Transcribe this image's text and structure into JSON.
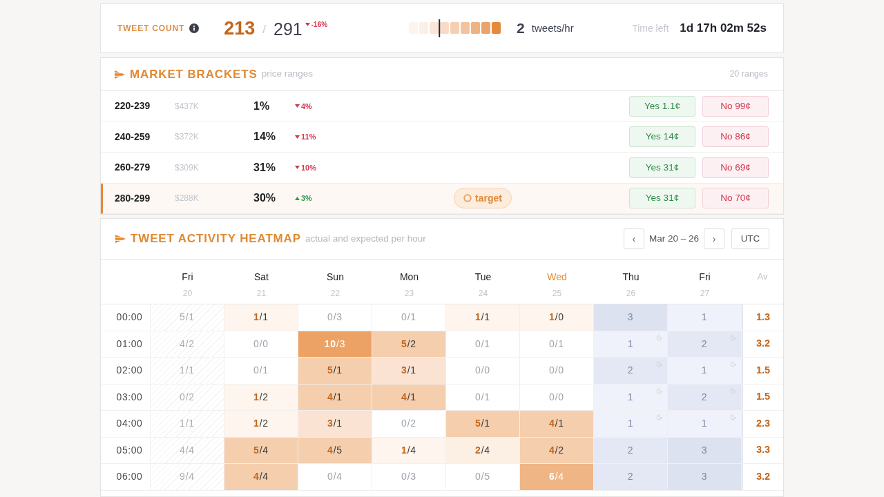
{
  "tweet_count": {
    "label": "TWEET COUNT",
    "current": "213",
    "separator": "/",
    "target": "291",
    "change": {
      "increase": false,
      "text": "-16%"
    }
  },
  "rate": {
    "level": 0.33,
    "value": "2",
    "unit": "tweets/hr"
  },
  "time_left": {
    "label": "Time left",
    "value": "1d 17h 02m 52s"
  },
  "market_brackets": {
    "title": "MARKET BRACKETS",
    "subtitle": "price ranges",
    "count": "20 ranges",
    "rows": [
      {
        "range": "220-239",
        "volume": "$437K",
        "probability": "1%",
        "change": {
          "increase": false,
          "text": "4%"
        },
        "target": false,
        "yes": "Yes 1.1¢",
        "no": "No 99¢"
      },
      {
        "range": "240-259",
        "volume": "$372K",
        "probability": "14%",
        "change": {
          "increase": false,
          "text": "11%"
        },
        "target": false,
        "yes": "Yes 14¢",
        "no": "No 86¢"
      },
      {
        "range": "260-279",
        "volume": "$309K",
        "probability": "31%",
        "change": {
          "increase": false,
          "text": "10%"
        },
        "target": false,
        "yes": "Yes 31¢",
        "no": "No 69¢"
      },
      {
        "range": "280-299",
        "volume": "$288K",
        "probability": "30%",
        "change": {
          "increase": true,
          "text": "3%"
        },
        "target": true,
        "tag": "target",
        "yes": "Yes 31¢",
        "no": "No 70¢"
      }
    ]
  },
  "heatmap": {
    "title": "TWEET ACTIVITY HEATMAP",
    "subtitle": "actual and expected per hour",
    "prev": "‹",
    "range": "Mar 20 – 26",
    "next": "›",
    "timezone": "UTC",
    "days": [
      {
        "name": "Fri",
        "date": "20",
        "today": false
      },
      {
        "name": "Sat",
        "date": "21",
        "today": false
      },
      {
        "name": "Sun",
        "date": "22",
        "today": false
      },
      {
        "name": "Mon",
        "date": "23",
        "today": false
      },
      {
        "name": "Tue",
        "date": "24",
        "today": false
      },
      {
        "name": "Wed",
        "date": "25",
        "today": true
      },
      {
        "name": "Thu",
        "date": "26",
        "today": false
      },
      {
        "name": "Fri",
        "date": "27",
        "today": false
      }
    ],
    "average_header": "Av",
    "rows": [
      {
        "time": "00:00",
        "average": "1.3",
        "cells": [
          {
            "kind": "past",
            "text": "5/1"
          },
          {
            "kind": "actual",
            "text": "**1**/1",
            "color": "#fdf5ee"
          },
          {
            "kind": "empty",
            "text": "0/3"
          },
          {
            "kind": "empty",
            "text": "0/1"
          },
          {
            "kind": "actual",
            "text": "**1**/1",
            "color": "#fdf5ee"
          },
          {
            "kind": "actual",
            "text": "**1**/0",
            "color": "#fdf5ee"
          },
          {
            "kind": "forecast",
            "text": "3",
            "color": "#dde2f1",
            "night": false
          },
          {
            "kind": "forecast",
            "text": "1",
            "color": "#eff2fa",
            "night": false
          }
        ]
      },
      {
        "time": "01:00",
        "average": "3.2",
        "cells": [
          {
            "kind": "past",
            "text": "4/2"
          },
          {
            "kind": "empty",
            "text": "0/0"
          },
          {
            "kind": "peak",
            "text": "**10**/3",
            "color": "#eca264"
          },
          {
            "kind": "actual",
            "text": "**5**/2",
            "color": "#f5ceae"
          },
          {
            "kind": "empty",
            "text": "0/1"
          },
          {
            "kind": "empty",
            "text": "0/1"
          },
          {
            "kind": "forecast",
            "text": "1",
            "color": "#eff2fa",
            "night": true
          },
          {
            "kind": "forecast",
            "text": "2",
            "color": "#e3e8f4",
            "night": true
          }
        ]
      },
      {
        "time": "02:00",
        "average": "1.5",
        "cells": [
          {
            "kind": "past",
            "text": "1/1"
          },
          {
            "kind": "empty",
            "text": "0/1"
          },
          {
            "kind": "actual",
            "text": "**5**/1",
            "color": "#f5ceae"
          },
          {
            "kind": "actual",
            "text": "**3**/1",
            "color": "#fae3d3"
          },
          {
            "kind": "empty",
            "text": "0/0"
          },
          {
            "kind": "empty",
            "text": "0/0"
          },
          {
            "kind": "forecast",
            "text": "2",
            "color": "#e3e8f4",
            "night": true
          },
          {
            "kind": "forecast",
            "text": "1",
            "color": "#eff2fa",
            "night": true
          }
        ]
      },
      {
        "time": "03:00",
        "average": "1.5",
        "cells": [
          {
            "kind": "past",
            "text": "0/2"
          },
          {
            "kind": "actual",
            "text": "**1**/2",
            "color": "#fdf5ee"
          },
          {
            "kind": "actual",
            "text": "**4**/1",
            "color": "#f5ceae"
          },
          {
            "kind": "actual",
            "text": "**4**/1",
            "color": "#f5ceae"
          },
          {
            "kind": "empty",
            "text": "0/1"
          },
          {
            "kind": "empty",
            "text": "0/0"
          },
          {
            "kind": "forecast",
            "text": "1",
            "color": "#eff2fa",
            "night": true
          },
          {
            "kind": "forecast",
            "text": "2",
            "color": "#e3e8f4",
            "night": true
          }
        ]
      },
      {
        "time": "04:00",
        "average": "2.3",
        "cells": [
          {
            "kind": "past",
            "text": "1/1"
          },
          {
            "kind": "actual",
            "text": "**1**/2",
            "color": "#fdf5ee"
          },
          {
            "kind": "actual",
            "text": "**3**/1",
            "color": "#fae3d3"
          },
          {
            "kind": "empty",
            "text": "0/2"
          },
          {
            "kind": "actual",
            "text": "**5**/1",
            "color": "#f5ceae"
          },
          {
            "kind": "actual",
            "text": "**4**/1",
            "color": "#f5ceae"
          },
          {
            "kind": "forecast",
            "text": "1",
            "color": "#eff2fa",
            "night": true
          },
          {
            "kind": "forecast",
            "text": "1",
            "color": "#eff2fa",
            "night": true
          }
        ]
      },
      {
        "time": "05:00",
        "average": "3.3",
        "cells": [
          {
            "kind": "past",
            "text": "4/4"
          },
          {
            "kind": "actual",
            "text": "**5**/4",
            "color": "#f5ceae"
          },
          {
            "kind": "actual",
            "text": "**4**/5",
            "color": "#f5ceae"
          },
          {
            "kind": "actual",
            "text": "**1**/4",
            "color": "#fdf5ee"
          },
          {
            "kind": "actual",
            "text": "**2**/4",
            "color": "#fcefe3"
          },
          {
            "kind": "actual",
            "text": "**4**/2",
            "color": "#f5ceae"
          },
          {
            "kind": "forecast",
            "text": "2",
            "color": "#e3e8f4",
            "night": false
          },
          {
            "kind": "forecast",
            "text": "3",
            "color": "#dde2f1",
            "night": false
          }
        ]
      },
      {
        "time": "06:00",
        "average": "3.2",
        "cells": [
          {
            "kind": "past",
            "text": "9/4"
          },
          {
            "kind": "actual",
            "text": "**4**/4",
            "color": "#f5ceae"
          },
          {
            "kind": "empty",
            "text": "0/4"
          },
          {
            "kind": "empty",
            "text": "0/3"
          },
          {
            "kind": "empty",
            "text": "0/5"
          },
          {
            "kind": "peak",
            "text": "**6**/4",
            "color": "#efb585"
          },
          {
            "kind": "forecast",
            "text": "2",
            "color": "#e3e8f4",
            "night": false
          },
          {
            "kind": "forecast",
            "text": "3",
            "color": "#dde2f1",
            "night": false
          }
        ]
      }
    ]
  }
}
